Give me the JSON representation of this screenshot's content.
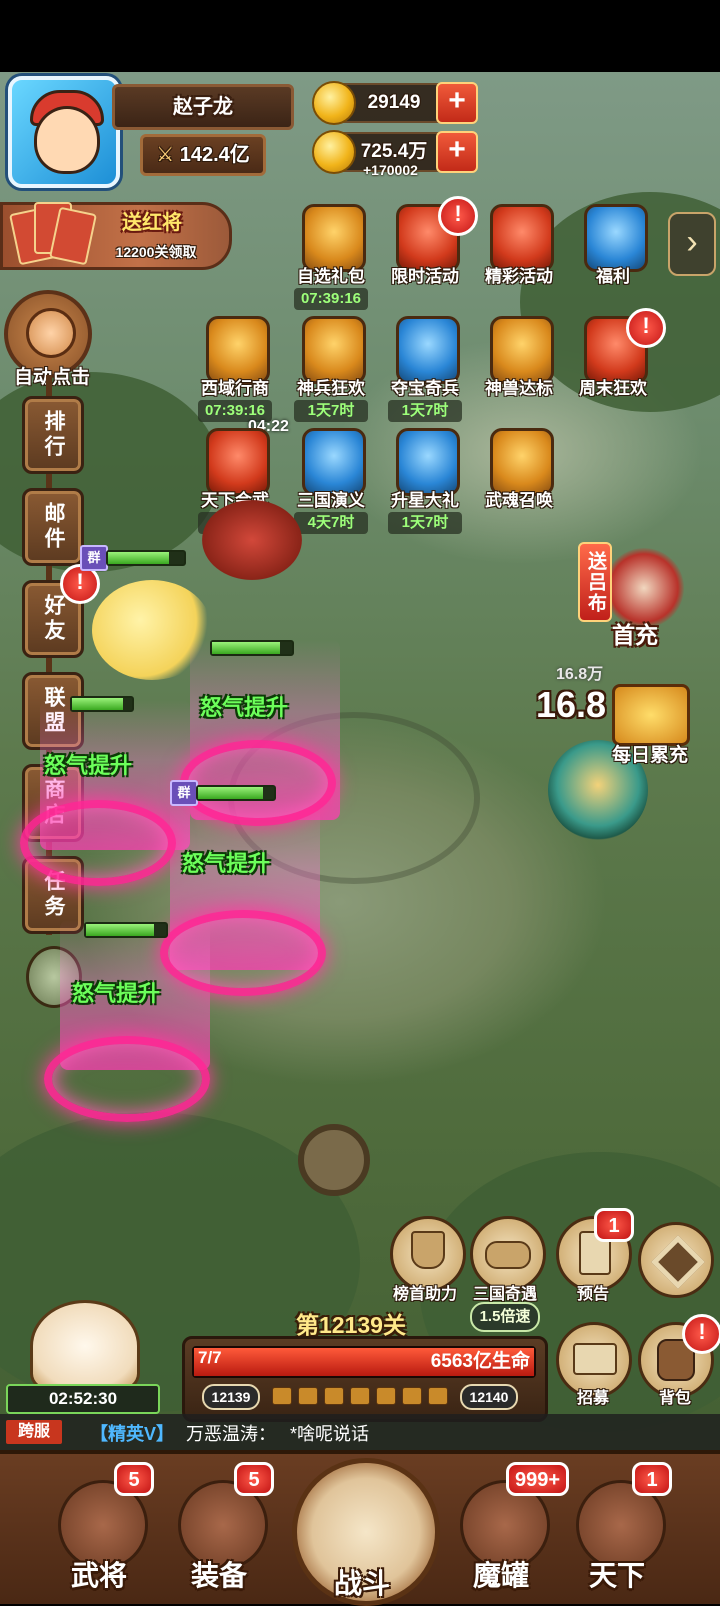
{
  "player": {
    "name": "赵子龙",
    "power": "142.4亿"
  },
  "resources": {
    "gold_ingot": "29149",
    "coins": "725.4万",
    "coins_gain": "+170002"
  },
  "gift_banner": {
    "title": "送红将",
    "subtitle": "12200关领取"
  },
  "auto_click": "自动点击",
  "side_menu": [
    {
      "label": "排行",
      "badge": false
    },
    {
      "label": "邮件",
      "badge": false
    },
    {
      "label": "好友",
      "badge": true
    },
    {
      "label": "联盟",
      "badge": false
    },
    {
      "label": "商店",
      "badge": false
    },
    {
      "label": "任务",
      "badge": false
    }
  ],
  "activities": [
    {
      "label": "自选礼包",
      "timer": "07:39:16",
      "badge": false
    },
    {
      "label": "限时活动",
      "timer": "",
      "badge": true
    },
    {
      "label": "精彩活动",
      "timer": "",
      "badge": false
    },
    {
      "label": "福利",
      "timer": "",
      "badge": false
    },
    {
      "label": "西域行商",
      "timer": "07:39:16",
      "badge": false
    },
    {
      "label": "神兵狂欢",
      "timer": "1天7时",
      "badge": false
    },
    {
      "label": "夺宝奇兵",
      "timer": "1天7时",
      "badge": false
    },
    {
      "label": "神兽达标",
      "timer": "",
      "badge": false
    },
    {
      "label": "周末狂欢",
      "timer": "",
      "badge": true
    },
    {
      "label": "天下会武",
      "timer": "1天7时",
      "badge": false
    },
    {
      "label": "三国演义",
      "timer": "4天7时",
      "badge": false
    },
    {
      "label": "升星大礼",
      "timer": "1天7时",
      "badge": false
    },
    {
      "label": "武魂召唤",
      "timer": "",
      "badge": false
    }
  ],
  "floating_timer": "04:22",
  "battle": {
    "faction_tag": "群",
    "rage_text": "怒气提升",
    "enemy_hp": "16.8万",
    "damage_text": "16.8",
    "first_charge": {
      "tag": "送吕布",
      "label": "首充"
    },
    "daily_recharge": "每日累充"
  },
  "right_buttons": {
    "rank_help": "榜首助力",
    "three_kingdoms": "三国奇遇",
    "preview": "预告",
    "preview_badge": "1",
    "recruit": "招募",
    "bag": "背包"
  },
  "stage": {
    "title": "第12139关",
    "speed": "1.5倍速",
    "wave": "7/7",
    "enemy_hp": "6563亿生命",
    "current_level": "12139",
    "next_level": "12140",
    "wave_progress": 1.0
  },
  "lucky_cat_timer": "02:52:30",
  "chat": {
    "channel": "跨服",
    "rank": "【精英V】",
    "user": "万恶温涛：",
    "message": "*啥呢说话"
  },
  "bottom_nav": [
    {
      "label": "武将",
      "badge": "5"
    },
    {
      "label": "装备",
      "badge": "5"
    },
    {
      "label": "战斗",
      "badge": ""
    },
    {
      "label": "魔罐",
      "badge": "999+"
    },
    {
      "label": "天下",
      "badge": "1"
    }
  ],
  "colors": {
    "rage_green": "#6cff5a",
    "badge_red": "#c21414",
    "timer_green": "#9dff7a",
    "chat_rank_blue": "#4fb8ff"
  }
}
